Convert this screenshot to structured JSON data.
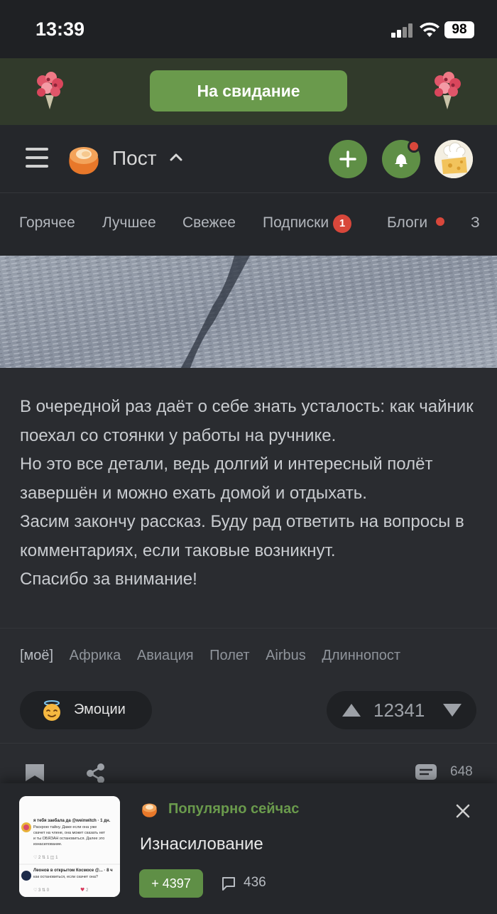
{
  "status_bar": {
    "time": "13:39",
    "battery": "98"
  },
  "promo": {
    "button_label": "На свидание"
  },
  "header": {
    "title": "Пост"
  },
  "tabs": [
    {
      "label": "Горячее"
    },
    {
      "label": "Лучшее"
    },
    {
      "label": "Свежее"
    },
    {
      "label": "Подписки",
      "badge": "1"
    },
    {
      "label": "Блоги"
    },
    {
      "label": "З"
    }
  ],
  "post": {
    "paragraphs": [
      "В очередной раз даёт о себе знать усталость: как чайник поехал со стоянки у работы на ручнике.",
      "Но это все детали, ведь долгий и интересный полёт завершён и можно ехать домой и отдыхать.",
      "Засим закончу рассказ. Буду рад ответить на вопросы в комментариях, если таковые возникнут.",
      "Спасибо за внимание!"
    ],
    "tags": [
      "[моё]",
      "Африка",
      "Авиация",
      "Полет",
      "Airbus",
      "Длиннопост"
    ],
    "emotions_label": "Эмоции",
    "rating": "12341",
    "comments_count": "648"
  },
  "popular": {
    "label": "Популярно сейчас",
    "title": "Изнасилование",
    "rating": "+ 4397",
    "comments": "436",
    "thumb": {
      "line1": "я тебя заебала да @weinwitch · 1 дн.",
      "line2": "Раскрою тайну. Даже если она уже скачет на члене, она может сказать нет и ты ОБЯЗАН остановиться. Далее это изнасилование.",
      "line3": "Леонов в открытом Космосе @... · 8 ч",
      "line4": "как остановиться, если скачет она?"
    }
  },
  "colors": {
    "accent_green": "#6a9a4c",
    "notification_red": "#d8473b",
    "background": "#2a2c30"
  },
  "icons": [
    "menu-icon",
    "pikabu-logo",
    "chevron-up-icon",
    "plus-icon",
    "bell-icon",
    "bookmark-icon",
    "share-icon",
    "comment-icon",
    "close-icon",
    "arrow-up-icon",
    "arrow-down-icon",
    "angel-emoji-icon",
    "bouquet-icon"
  ]
}
